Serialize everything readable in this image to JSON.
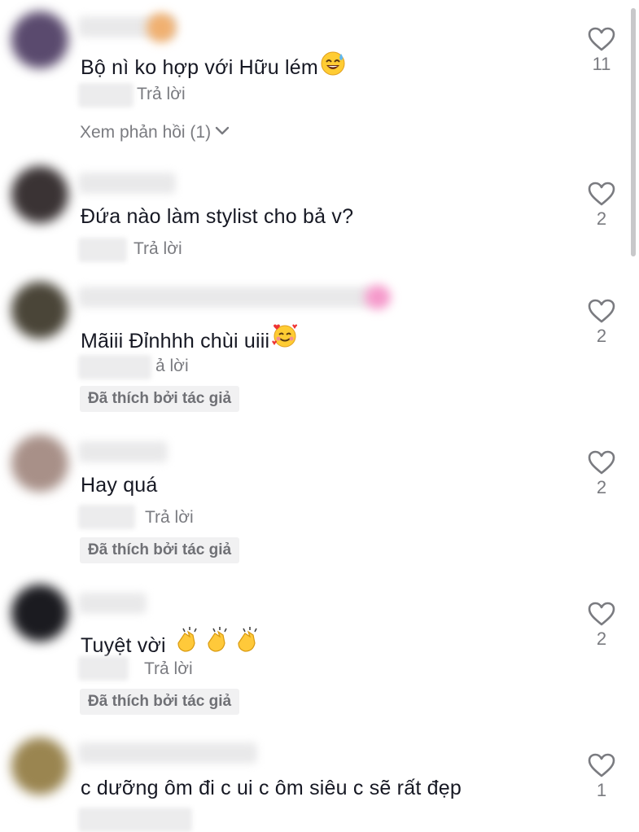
{
  "comments": [
    {
      "text": "Bộ nì ko hợp với Hữu lém",
      "emoji": "sweat-smile-emoji",
      "reply_label": "Trả lời",
      "view_replies": "Xem phản hồi (1)",
      "likes": "11",
      "avatar_color": "#5a4a6e"
    },
    {
      "text": "Đứa nào làm stylist cho bả v?",
      "reply_label": "Trả lời",
      "likes": "2",
      "avatar_color": "#3a3334"
    },
    {
      "text": "Mãiii Đỉnhhh chùi uiii",
      "emoji": "smiling-hearts-emoji",
      "reply_label": "ả lời",
      "liked_by_author": "Đã thích bởi tác giả",
      "likes": "2",
      "avatar_color": "#4a4538"
    },
    {
      "text": "Hay quá",
      "reply_label": "Trả lời",
      "liked_by_author": "Đã thích bởi tác giả",
      "likes": "2",
      "avatar_color": "#a89088"
    },
    {
      "text": "Tuyệt vời",
      "emoji": "clapping-hands-emoji",
      "reply_label": "Trả lời",
      "liked_by_author": "Đã thích bởi tác giả",
      "likes": "2",
      "avatar_color": "#1b1b20"
    },
    {
      "text": "c dưỡng ôm đi c ui c ôm siêu c sẽ rất đẹp",
      "likes": "1",
      "avatar_color": "#9a8550"
    }
  ],
  "colors": {
    "text_primary": "#161823",
    "text_secondary": "#7a7b80",
    "badge_bg": "#f1f1f2"
  },
  "icons": {
    "like": "heart-outline-icon",
    "expand": "chevron-down-icon"
  }
}
